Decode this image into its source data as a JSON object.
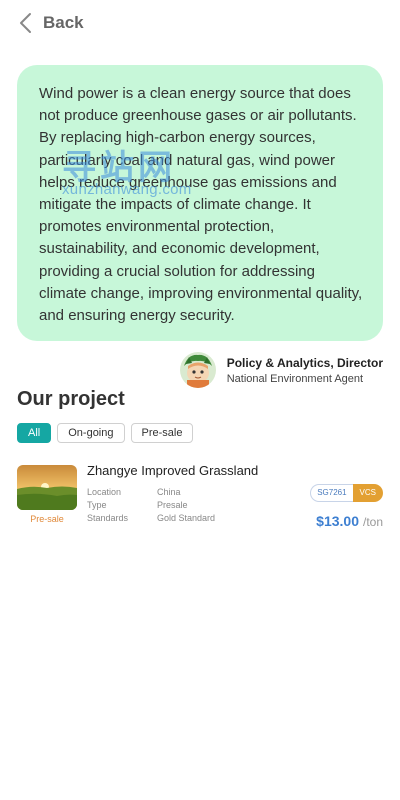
{
  "nav": {
    "back_label": "Back"
  },
  "quote": {
    "text": "Wind power is a clean energy source that does not produce greenhouse gases or air pollutants. By replacing high-carbon energy sources, particularly coal and natural gas, wind power helps reduce greenhouse gas emissions and mitigate the impacts of climate change. It promotes environmental protection, sustainability, and economic development, providing a crucial solution for addressing climate change, improving environmental quality, and ensuring energy security."
  },
  "watermark": {
    "cn": "寻站网",
    "en": "xunzhanwang.com"
  },
  "author": {
    "name": "Policy & Analytics, Director",
    "org": "National Environment Agent"
  },
  "section": {
    "title": "Our project"
  },
  "filters": [
    {
      "label": "All",
      "active": true
    },
    {
      "label": "On-going",
      "active": false
    },
    {
      "label": "Pre-sale",
      "active": false
    }
  ],
  "project": {
    "title": "Zhangye Improved Grassland",
    "thumb_tag": "Pre-sale",
    "meta": [
      {
        "key": "Location",
        "value": "China"
      },
      {
        "key": "Type",
        "value": "Presale"
      },
      {
        "key": "Standards",
        "value": "Gold Standard"
      }
    ],
    "badge_id": "SG7261",
    "badge_std": "VCS",
    "price": "$13.00",
    "unit": "/ton"
  },
  "colors": {
    "card_bg": "#c7f7d9",
    "accent_teal": "#15a7a3",
    "price_blue": "#3d7fd1",
    "badge_orange": "#e3a032",
    "presale_orange": "#e0893a"
  },
  "icons": {
    "back": "chevron-left-icon",
    "avatar": "cartoon-avatar"
  }
}
